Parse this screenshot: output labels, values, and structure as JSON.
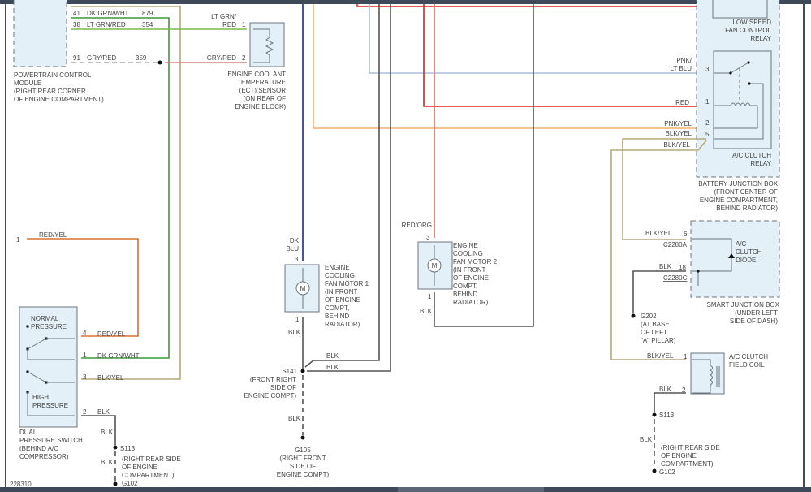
{
  "colors": {
    "dk_grn_wht": "#3a9a3a",
    "blk_yel": "#b5a878",
    "lt_grn_red": "#7ab848",
    "gry_red": "#d88080",
    "red_yel": "#d87030",
    "blk": "#555555",
    "dk_blu": "#1a2a80",
    "pnk_yel": "#f2b070",
    "pnk_lt_blu": "#a8c0d8",
    "red": "#e02020",
    "red_org": "#f06848",
    "component_fill": "#e4f0f8"
  },
  "pcm": {
    "pins": [
      {
        "num": "41",
        "color": "DK GRN/WHT",
        "circuit": "879"
      },
      {
        "num": "38",
        "color": "LT GRN/RED",
        "circuit": "354"
      },
      {
        "num": "91",
        "color": "GRY/RED",
        "circuit": "359"
      }
    ],
    "label": [
      "POWERTRAIN CONTROL",
      "MODULE",
      "(RIGHT REAR CORNER",
      "OF ENGINE COMPARTMENT)"
    ]
  },
  "ect": {
    "pin1_color": [
      "LT GRN/",
      "RED"
    ],
    "pin1": "1",
    "pin2_color": "GRY/RED",
    "pin2": "2",
    "label": [
      "ENGINE COOLANT",
      "TEMPERATURE",
      "(ECT) SENSOR",
      "(ON REAR OF",
      "ENGINE BLOCK)"
    ]
  },
  "red_yel_wire": {
    "pin": "1",
    "color": "RED/YEL"
  },
  "dual_switch": {
    "normal": [
      "NORMAL",
      "PRESSURE"
    ],
    "high": [
      "HIGH",
      "PRESSURE"
    ],
    "pins": [
      {
        "num": "4",
        "color": "RED/YEL"
      },
      {
        "num": "1",
        "color": "DK GRN/WHT"
      },
      {
        "num": "3",
        "color": "BLK/YEL"
      },
      {
        "num": "2",
        "color": "BLK"
      }
    ],
    "label": [
      "DUAL",
      "PRESSURE SWITCH",
      "(BEHIND A/C",
      "COMPRESSOR)"
    ],
    "wire_blk": "BLK",
    "splice": "S113",
    "splice_blk": "BLK",
    "splice_loc": [
      "(RIGHT REAR SIDE",
      "OF ENGINE",
      "COMPARTMENT)"
    ],
    "ground": "G102"
  },
  "diagram_id": "228310",
  "fan1": {
    "wire_top": [
      "DK",
      "BLU"
    ],
    "pin_top": "3",
    "pin_bottom": "1",
    "motor": "M",
    "wire_bottom": "BLK",
    "label": [
      "ENGINE",
      "COOLING",
      "FAN MOTOR 1",
      "(IN FRONT",
      "OF ENGINE",
      "COMPT,",
      "BEHIND",
      "RADIATOR)"
    ],
    "splice": "S141",
    "splice_loc": [
      "(FRONT RIGHT",
      "SIDE OF",
      "ENGINE COMPT)"
    ],
    "splice_wires": [
      "BLK",
      "BLK"
    ],
    "ground_wire": "BLK",
    "ground": "G105",
    "ground_loc": [
      "(RIGHT FRONT",
      "SIDE OF",
      "ENGINE COMPT)"
    ]
  },
  "fan2": {
    "wire_top": "RED/ORG",
    "pin_top": "3",
    "pin_bottom": "1",
    "motor": "M",
    "wire_bottom": "BLK",
    "label": [
      "ENGINE",
      "COOLING",
      "FAN MOTOR 2",
      "(IN FRONT",
      "OF ENGINE",
      "COMPT,",
      "BEHIND",
      "RADIATOR)"
    ]
  },
  "bjb": {
    "low_speed_relay": [
      "LOW SPEED",
      "FAN CONTROL",
      "RELAY"
    ],
    "pins": [
      {
        "num": "3",
        "color": [
          "PNK/",
          "LT BLU"
        ]
      },
      {
        "num": "1",
        "color": "RED"
      },
      {
        "num": "2",
        "color": "PNK/YEL"
      },
      {
        "num": "5",
        "color": "BLK/YEL"
      }
    ],
    "pin5_out": "BLK/YEL",
    "relay": [
      "A/C CLUTCH",
      "RELAY"
    ],
    "label": [
      "BATTERY JUNCTION BOX",
      "(FRONT CENTER OF",
      "ENGINE COMPARTMENT,",
      "BEHIND RADIATOR)"
    ]
  },
  "sjb": {
    "pin6": {
      "num": "6",
      "color": "BLK/YEL",
      "connector": "C2280A"
    },
    "pin18": {
      "num": "18",
      "color": "BLK",
      "connector": "C2280C"
    },
    "diode": [
      "A/C",
      "CLUTCH",
      "DIODE"
    ],
    "label": [
      "SMART JUNCTION BOX",
      "(UNDER LEFT",
      "SIDE OF DASH)"
    ],
    "ground": "G202",
    "ground_loc": [
      "(AT BASE",
      "OF LEFT",
      "\"A\" PILLAR)"
    ]
  },
  "coil": {
    "pin1": {
      "num": "1",
      "color": "BLK/YEL"
    },
    "pin2": {
      "num": "2",
      "color": "BLK"
    },
    "label": [
      "A/C CLUTCH",
      "FIELD COIL"
    ],
    "splice": "S113",
    "blk": "BLK",
    "splice_loc": [
      "(RIGHT REAR SIDE",
      "OF ENGINE",
      "COMPARTMENT)"
    ],
    "ground": "G102"
  }
}
